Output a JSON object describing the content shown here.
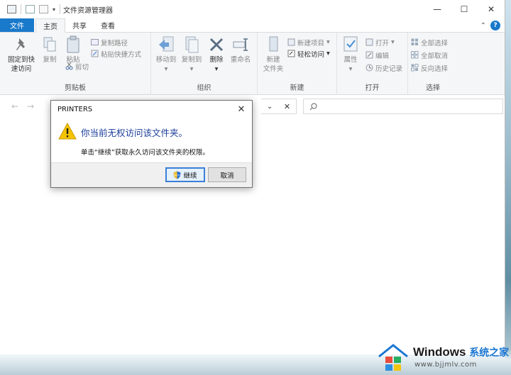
{
  "window": {
    "title": "文件资源管理器",
    "controls": {
      "minimize": "—",
      "maximize": "☐",
      "close": "✕"
    }
  },
  "ribbon_tabs": {
    "file": "文件",
    "home": "主页",
    "share": "共享",
    "view": "查看"
  },
  "ribbon": {
    "clipboard": {
      "label": "剪贴板",
      "pin_line1": "固定到快",
      "pin_line2": "速访问",
      "copy": "复制",
      "paste": "粘贴",
      "copy_path": "复制路径",
      "paste_shortcut": "粘贴快捷方式",
      "cut": "剪切"
    },
    "organize": {
      "label": "组织",
      "move_to": "移动到",
      "copy_to": "复制到",
      "delete": "删除",
      "rename": "重命名"
    },
    "new": {
      "label": "新建",
      "new_folder_line1": "新建",
      "new_folder_line2": "文件夹",
      "new_item": "新建项目",
      "easy_access": "轻松访问"
    },
    "open": {
      "label": "打开",
      "properties": "属性",
      "open": "打开",
      "edit": "编辑",
      "history": "历史记录"
    },
    "select": {
      "label": "选择",
      "select_all": "全部选择",
      "select_none": "全部取消",
      "invert": "反向选择"
    }
  },
  "dialog": {
    "title": "PRINTERS",
    "main_text": "你当前无权访问该文件夹。",
    "sub_text": "单击“继续”获取永久访问该文件夹的权限。",
    "continue_label": "继续",
    "cancel_label": "取消"
  },
  "watermark": {
    "brand": "Windows",
    "site_name": "系统之家",
    "url": "www.bjjmlv.com"
  },
  "colors": {
    "accent": "#1979ca",
    "dialog_heading": "#1a3c9b",
    "warning": "#f5c400"
  }
}
